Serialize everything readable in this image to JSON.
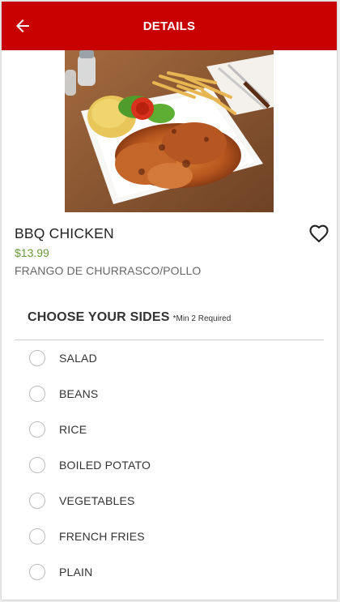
{
  "header": {
    "title": "DETAILS",
    "back_icon": "arrow-left-icon",
    "color": "#c90000"
  },
  "item": {
    "name": "BBQ CHICKEN",
    "price": "$13.99",
    "description": "FRANGO DE CHURRASCO/POLLO",
    "favorite_icon": "heart-outline-icon",
    "price_color": "#6a9a3a"
  },
  "sides": {
    "title": "CHOOSE YOUR SIDES",
    "requirement": "*Min 2 Required",
    "options": [
      {
        "label": "SALAD"
      },
      {
        "label": "BEANS"
      },
      {
        "label": "RICE"
      },
      {
        "label": "BOILED POTATO"
      },
      {
        "label": "VEGETABLES"
      },
      {
        "label": "FRENCH FRIES"
      },
      {
        "label": "PLAIN"
      }
    ]
  }
}
